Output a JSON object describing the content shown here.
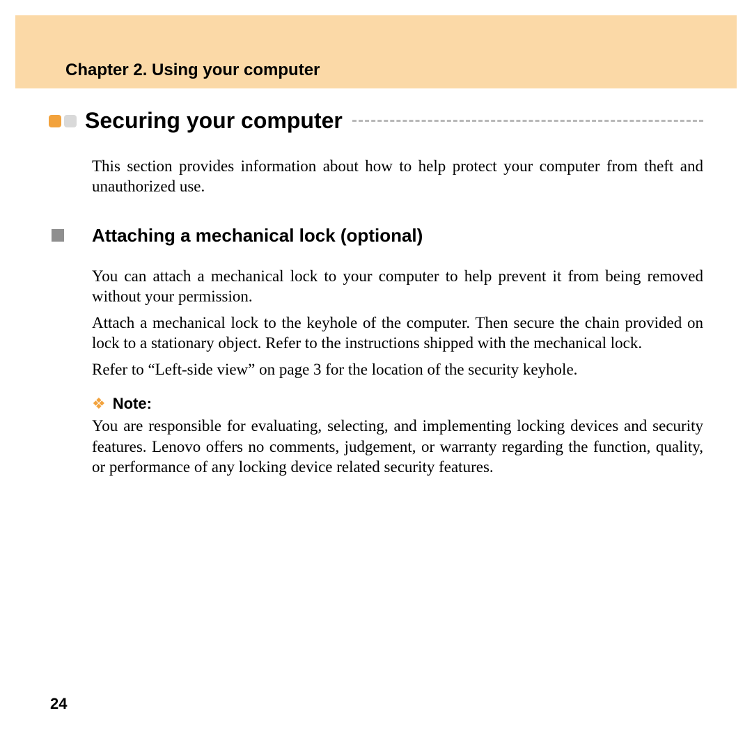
{
  "chapter": "Chapter 2. Using your computer",
  "section_title": "Securing your computer",
  "intro": "This section provides information about how to help protect your computer from theft and unauthorized use.",
  "subsection_title": "Attaching a mechanical lock (optional)",
  "para1": "You can attach a mechanical lock to your computer to help prevent it from being removed without your permission.",
  "para2": "Attach a mechanical lock to the keyhole of the computer. Then secure the chain provided on lock to a stationary object. Refer to the instructions shipped with the mechanical lock.",
  "para3": "Refer to “Left-side view” on page 3 for the location of the security keyhole.",
  "note_label": "Note:",
  "note_body": "You are responsible for evaluating, selecting, and implementing locking devices and security features. Lenovo offers no comments, judgement, or warranty regarding the function, quality, or performance of any locking device related security features.",
  "page_number": "24"
}
